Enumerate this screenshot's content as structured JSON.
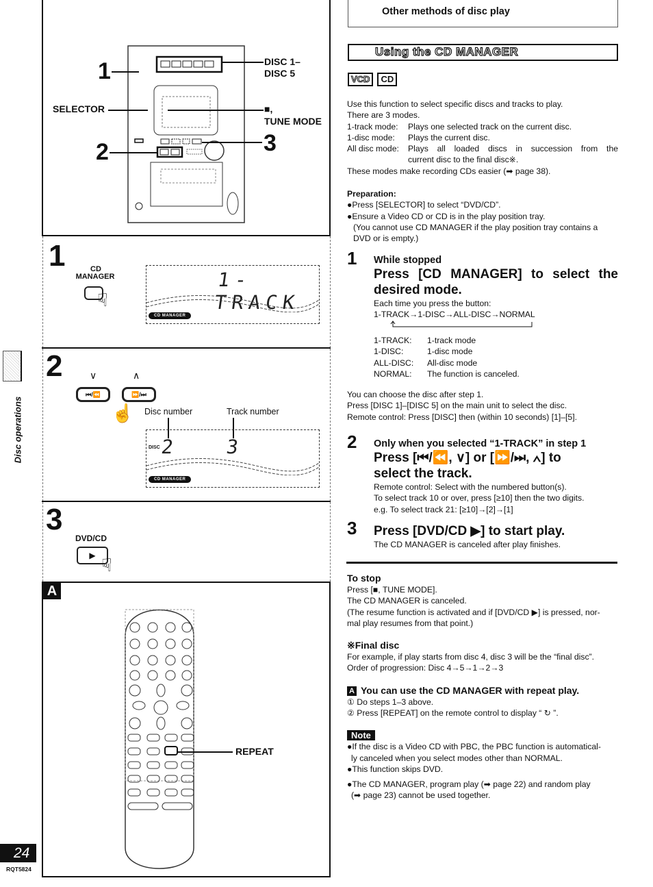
{
  "header": {
    "section_title": "Other methods of disc play",
    "feature_title": "Using the CD MANAGER",
    "disc_tags": [
      "VCD",
      "CD"
    ]
  },
  "intro": {
    "line1": "Use this function to select specific discs and tracks to play.",
    "line2": "There are 3 modes.",
    "modes": [
      {
        "key": "1-track mode:",
        "desc": "Plays one selected track on the current disc."
      },
      {
        "key": "1-disc mode:",
        "desc": "Plays the current disc."
      },
      {
        "key": "All disc mode:",
        "desc": "Plays all loaded discs in succession from the",
        "desc2": "current disc to the final disc※."
      }
    ],
    "recording_note": "These modes make recording CDs easier (➡ page 38)."
  },
  "preparation": {
    "title": "Preparation:",
    "items": [
      "●Press [SELECTOR] to select “DVD/CD”.",
      "●Ensure a Video CD or CD is in the play position tray."
    ],
    "sub1": "(You cannot use CD MANAGER if the play position tray contains a",
    "sub2": "DVD or is empty.)"
  },
  "step1": {
    "number": "1",
    "condition": "While stopped",
    "heading_line1": "Press [CD MANAGER] to select the",
    "heading_line2": "desired mode.",
    "each_time": "Each time you press the button:",
    "sequence": "1-TRACK→1-DISC→ALL-DISC→NORMAL",
    "modes": [
      {
        "key": "1-TRACK:",
        "desc": "1-track mode"
      },
      {
        "key": "1-DISC:",
        "desc": "1-disc mode"
      },
      {
        "key": "ALL-DISC:",
        "desc": "All-disc mode"
      },
      {
        "key": "NORMAL:",
        "desc": "The function is canceled."
      }
    ],
    "after1": "You can choose the disc after step 1.",
    "after2": "Press [DISC 1]–[DISC 5] on the main unit to select the disc.",
    "after3": "Remote control:  Press [DISC] then (within 10 seconds) [1]–[5]."
  },
  "step2": {
    "number": "2",
    "condition": "Only when you selected “1-TRACK” in step 1",
    "heading_line1": "Press [⏮/⏪, ∨] or [⏩/⏭, ∧] to",
    "heading_line2": "select the track.",
    "line1": "Remote control:  Select with the numbered button(s).",
    "line2": "To select track 10 or over, press [≥10] then the two digits.",
    "line3": "e.g. To select track 21:  [≥10]→[2]→[1]"
  },
  "step3": {
    "number": "3",
    "heading": "Press [DVD/CD ▶] to start play.",
    "line1": "The CD MANAGER is canceled after play finishes."
  },
  "to_stop": {
    "title": "To stop",
    "line1": "Press [■, TUNE MODE].",
    "line2": "The CD MANAGER is canceled.",
    "line3": "(The resume function is activated and if [DVD/CD ▶] is pressed, nor-",
    "line4": "mal play resumes from that point.)"
  },
  "final_disc": {
    "title": "※Final disc",
    "line1": "For example, if play starts from disc 4, disc 3 will be the “final disc”.",
    "line2": "Order of progression:  Disc 4→5→1→2→3"
  },
  "repeat_section": {
    "badge": "A",
    "title": "You can use the CD MANAGER with repeat play.",
    "step1": "①  Do steps 1–3 above.",
    "step2": "②  Press [REPEAT] on the remote control to display “ ↻ ”."
  },
  "note": {
    "badge": "Note",
    "items": [
      "●If the disc is a Video CD with PBC, the PBC function is automatical-",
      "  ly canceled when you select modes other than NORMAL.",
      "●This function skips DVD.",
      "●The CD MANAGER, program play (➡ page 22) and random play",
      "  (➡ page 23) cannot be used together."
    ]
  },
  "illustrations": {
    "unit": {
      "callout_1": "1",
      "callout_2": "2",
      "callout_3": "3",
      "selector": "SELECTOR",
      "disc_label1": "DISC 1–",
      "disc_label2": "DISC 5",
      "stop_label1": "■,",
      "stop_label2": "TUNE MODE"
    },
    "panel1": {
      "step": "1",
      "button_label1": "CD",
      "button_label2": "MANAGER",
      "display_text": "1-TRACK",
      "badge": "CD MANAGER"
    },
    "panel2": {
      "step": "2",
      "down_symbol": "∨",
      "up_symbol": "∧",
      "prev_button": "⏮/⏪",
      "next_button": "⏩/⏭",
      "disc_number_label": "Disc number",
      "track_number_label": "Track number",
      "disc_icon_label": "DISC",
      "disc_value": "2",
      "track_value": "3",
      "badge": "CD MANAGER"
    },
    "panel3": {
      "step": "3",
      "button_label": "DVD/CD",
      "play_symbol": "▶"
    },
    "panelA": {
      "badge": "A",
      "repeat_label": "REPEAT"
    }
  },
  "side_tab": {
    "label": "Disc operations"
  },
  "footer": {
    "page_number": "24",
    "doc_code": "RQT5824"
  }
}
